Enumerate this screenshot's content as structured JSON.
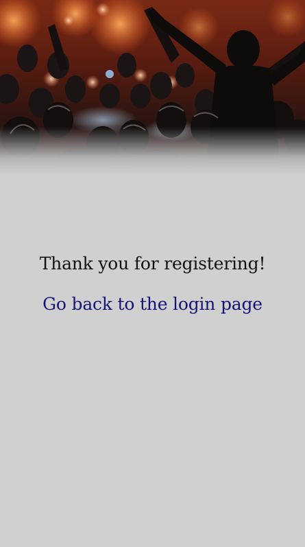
{
  "hero": {
    "image": "concert-crowd-image"
  },
  "message": {
    "text": "Thank you for registering!"
  },
  "link": {
    "text": "Go back to the login page"
  },
  "colors": {
    "background": "#d0d0d0",
    "message_text": "#111111",
    "link_text": "#141476"
  }
}
